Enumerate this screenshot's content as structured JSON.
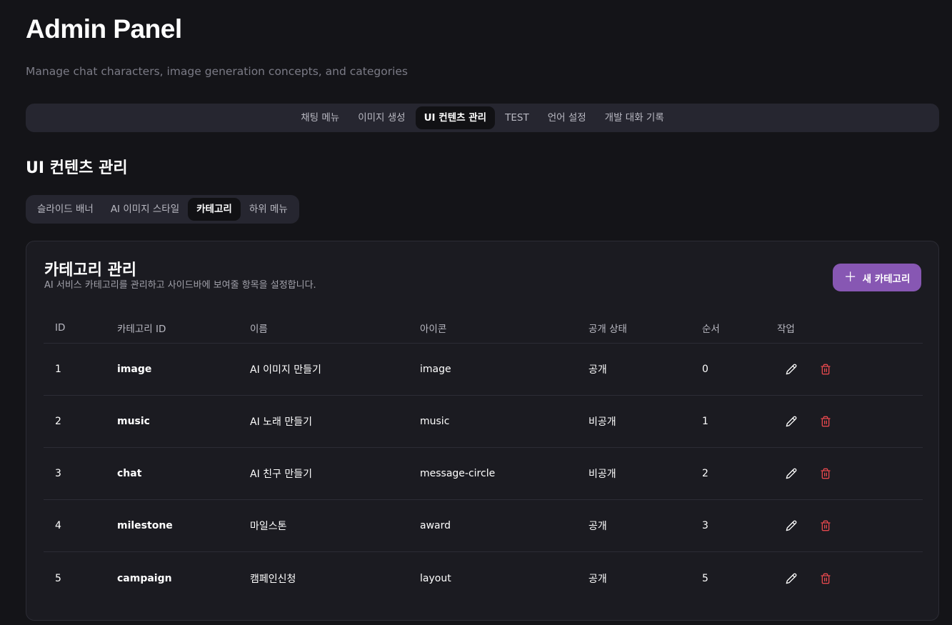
{
  "header": {
    "title": "Admin Panel",
    "subtitle": "Manage chat characters, image generation concepts, and categories"
  },
  "main_tabs": [
    {
      "label": "채팅 메뉴",
      "active": false
    },
    {
      "label": "이미지 생성",
      "active": false
    },
    {
      "label": "UI 컨텐츠 관리",
      "active": true
    },
    {
      "label": "TEST",
      "active": false
    },
    {
      "label": "언어 설정",
      "active": false
    },
    {
      "label": "개발 대화 기록",
      "active": false
    }
  ],
  "section": {
    "title": "UI 컨텐츠 관리"
  },
  "sub_tabs": [
    {
      "label": "슬라이드 배너",
      "active": false
    },
    {
      "label": "AI 이미지 스타일",
      "active": false
    },
    {
      "label": "카테고리",
      "active": true
    },
    {
      "label": "하위 메뉴",
      "active": false
    }
  ],
  "card": {
    "title": "카테고리 관리",
    "description": "AI 서비스 카테고리를 관리하고 사이드바에 보여줄 항목을 설정합니다.",
    "add_button": "새 카테고리"
  },
  "table": {
    "columns": [
      "ID",
      "카테고리 ID",
      "이름",
      "아이콘",
      "공개 상태",
      "순서",
      "작업"
    ],
    "rows": [
      [
        "1",
        "image",
        "AI 이미지 만들기",
        "image",
        "공개",
        "0"
      ],
      [
        "2",
        "music",
        "AI 노래 만들기",
        "music",
        "비공개",
        "1"
      ],
      [
        "3",
        "chat",
        "AI 친구 만들기",
        "message-circle",
        "비공개",
        "2"
      ],
      [
        "4",
        "milestone",
        "마일스톤",
        "award",
        "공개",
        "3"
      ],
      [
        "5",
        "campaign",
        "캠페인신청",
        "layout",
        "공개",
        "5"
      ]
    ]
  },
  "icons": {
    "add": "plus-icon",
    "edit": "pencil-icon",
    "delete": "trash-icon"
  },
  "colors": {
    "accent": "#8757b3",
    "delete": "#e5484d",
    "background": "#141418",
    "card": "#1b1b21"
  }
}
